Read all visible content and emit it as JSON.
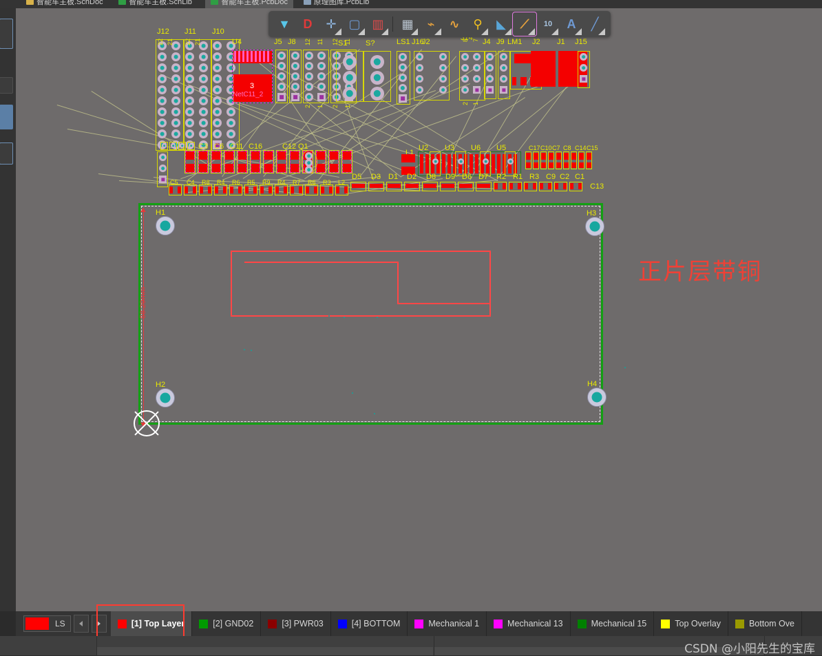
{
  "app": {
    "document_tabs": [
      {
        "label": "智能车主板.SchDoc",
        "icon": "schematic-doc-icon",
        "color": "#d8b24a",
        "active": false
      },
      {
        "label": "智能车主板.SchLib",
        "icon": "schematic-lib-icon",
        "color": "#2f9e44",
        "active": false
      },
      {
        "label": "智能车主板.PcbDoc",
        "icon": "pcb-doc-icon",
        "color": "#2f9e44",
        "active": true
      },
      {
        "label": "原理图库.PcbLib",
        "icon": "pcb-lib-icon",
        "color": "#8aa0b8",
        "active": false
      }
    ]
  },
  "toolbar": {
    "buttons": [
      {
        "name": "filter-icon",
        "glyph": "▼",
        "color": "#58c6e8",
        "caret": false,
        "boxed": false
      },
      {
        "name": "magnet-snap-icon",
        "glyph": "D",
        "color": "#e03a3a",
        "caret": false,
        "boxed": false
      },
      {
        "name": "crosshair-place-icon",
        "glyph": "✛",
        "color": "#8fb6e0",
        "caret": true,
        "boxed": false
      },
      {
        "name": "selection-rectangle-icon",
        "glyph": "▢",
        "color": "#6f9ad4",
        "caret": true,
        "boxed": false
      },
      {
        "name": "layer-stack-icon",
        "glyph": "▥",
        "color": "#e04a4a",
        "caret": true,
        "boxed": false
      },
      {
        "name": "component-place-icon",
        "glyph": "▦",
        "color": "#b9c4cf",
        "caret": true,
        "boxed": false
      },
      {
        "name": "route-track-icon",
        "glyph": "⌁",
        "color": "#e8a33d",
        "caret": true,
        "boxed": false
      },
      {
        "name": "differential-pair-icon",
        "glyph": "∿",
        "color": "#e8a33d",
        "caret": false,
        "boxed": false
      },
      {
        "name": "place-via-icon",
        "glyph": "⚲",
        "color": "#f0c020",
        "caret": true,
        "boxed": false
      },
      {
        "name": "polygon-pour-icon",
        "glyph": "◣",
        "color": "#59a6d8",
        "caret": true,
        "boxed": false
      },
      {
        "name": "place-line-icon",
        "glyph": "⟋",
        "color": "#e8a33d",
        "caret": true,
        "boxed": true
      },
      {
        "name": "dimension-icon",
        "glyph": "10",
        "color": "#a8c4e0",
        "caret": true,
        "boxed": false
      },
      {
        "name": "place-string-icon",
        "glyph": "A",
        "color": "#6f9ad4",
        "caret": true,
        "boxed": false
      },
      {
        "name": "place-line-segment-icon",
        "glyph": "╱",
        "color": "#6f9ad4",
        "caret": true,
        "boxed": false
      }
    ]
  },
  "layer_bar": {
    "current_swatch_color": "#ff0000",
    "current_swatch_label": "LS",
    "prev_label": "◀",
    "next_label": "▶",
    "tabs": [
      {
        "label": "[1] Top Layer",
        "color": "#ff0000",
        "active": true
      },
      {
        "label": "[2] GND02",
        "color": "#009a00",
        "active": false
      },
      {
        "label": "[3] PWR03",
        "color": "#8b0000",
        "active": false
      },
      {
        "label": "[4] BOTTOM",
        "color": "#0000ff",
        "active": false
      },
      {
        "label": "Mechanical 1",
        "color": "#ff00ff",
        "active": false
      },
      {
        "label": "Mechanical 13",
        "color": "#ff00ff",
        "active": false
      },
      {
        "label": "Mechanical 15",
        "color": "#008000",
        "active": false
      },
      {
        "label": "Top Overlay",
        "color": "#ffff00",
        "active": false
      },
      {
        "label": "Bottom Ove",
        "color": "#9a9a00",
        "active": false
      }
    ],
    "highlight_color": "#ff3b30"
  },
  "canvas": {
    "annotation": {
      "text": "正片层带铜",
      "color": "#ef4136"
    },
    "dimension": {
      "text": "58.29mm",
      "color": "#e33a3a"
    },
    "background_color": "#6e6b6b",
    "board_outline_color": "#13a013",
    "keepout_color": "#ff4646",
    "designators": {
      "top_row": [
        "J12",
        "J11",
        "J10",
        "U4",
        "J5",
        "J8",
        "S1",
        "S?",
        "LS1",
        "J16",
        "J2",
        "J14",
        "J4",
        "J9",
        "LM1",
        "J2",
        "J1",
        "J15"
      ],
      "pin_numbers": [
        "22",
        "21",
        "22",
        "21",
        "12",
        "11",
        "12",
        "11",
        "2",
        "1",
        "2",
        "1",
        "8",
        "7",
        "2",
        "1"
      ],
      "net_label": "NetC11_2",
      "pad_number": "3",
      "second_row": [
        "C3",
        "C6",
        "C11",
        "C16",
        "C12",
        "Q1",
        "L1",
        "U2",
        "U3",
        "U6",
        "U5",
        "C17",
        "C10",
        "C7",
        "C8",
        "C14",
        "C15"
      ],
      "third_row": [
        "C5",
        "C4",
        "R8",
        "R4",
        "R6",
        "R5",
        "R9",
        "R4",
        "R7",
        "R6",
        "R3",
        "L2",
        "D5",
        "D3",
        "D1",
        "D2",
        "D8",
        "D9",
        "D6",
        "D7",
        "R2",
        "R1",
        "R3",
        "C9",
        "C2",
        "C1",
        "C13"
      ],
      "mounting_holes": [
        "H1",
        "H2",
        "H3",
        "H4"
      ]
    }
  },
  "watermark": {
    "text": "CSDN @小阳先生的宝库"
  }
}
